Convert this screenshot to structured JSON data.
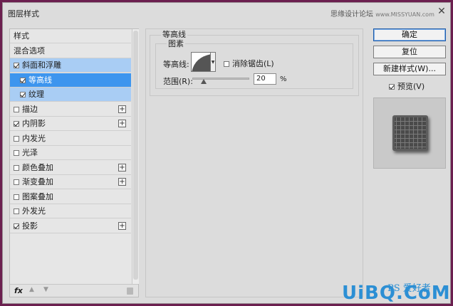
{
  "window": {
    "title": "图层样式",
    "watermark": "思缘设计论坛",
    "watermark_url": "www.MISSYUAN.com",
    "close": "✕"
  },
  "stylelist": {
    "items": [
      {
        "label": "样式",
        "checkbox": false,
        "checked": false,
        "plus": false,
        "state": "normal"
      },
      {
        "label": "混合选项",
        "checkbox": false,
        "checked": false,
        "plus": false,
        "state": "normal"
      },
      {
        "label": "斜面和浮雕",
        "checkbox": true,
        "checked": true,
        "plus": false,
        "state": "light"
      },
      {
        "label": "等高线",
        "checkbox": true,
        "checked": true,
        "plus": false,
        "state": "dark",
        "indent": true
      },
      {
        "label": "纹理",
        "checkbox": true,
        "checked": true,
        "plus": false,
        "state": "light",
        "indent": true
      },
      {
        "label": "描边",
        "checkbox": true,
        "checked": false,
        "plus": true,
        "state": "normal"
      },
      {
        "label": "内阴影",
        "checkbox": true,
        "checked": true,
        "plus": true,
        "state": "normal"
      },
      {
        "label": "内发光",
        "checkbox": true,
        "checked": false,
        "plus": false,
        "state": "normal"
      },
      {
        "label": "光泽",
        "checkbox": true,
        "checked": false,
        "plus": false,
        "state": "normal"
      },
      {
        "label": "颜色叠加",
        "checkbox": true,
        "checked": false,
        "plus": true,
        "state": "normal"
      },
      {
        "label": "渐变叠加",
        "checkbox": true,
        "checked": false,
        "plus": true,
        "state": "normal"
      },
      {
        "label": "图案叠加",
        "checkbox": true,
        "checked": false,
        "plus": false,
        "state": "normal"
      },
      {
        "label": "外发光",
        "checkbox": true,
        "checked": false,
        "plus": false,
        "state": "normal"
      },
      {
        "label": "投影",
        "checkbox": true,
        "checked": true,
        "plus": true,
        "state": "normal"
      }
    ],
    "footer": {
      "fx": "fx"
    }
  },
  "contour_panel": {
    "group_title": "等高线",
    "subgroup_title": "图素",
    "contour_label": "等高线:",
    "antialias_label": "消除锯齿(L)",
    "antialias_checked": false,
    "range_label": "范围(R):",
    "range_value": "20",
    "range_unit": "%",
    "range_fraction": 0.2
  },
  "buttons": {
    "ok": "确定",
    "reset": "复位",
    "new_style": "新建样式(W)...",
    "preview_label": "预览(V)",
    "preview_checked": true
  },
  "logo": {
    "text": "UiBQ.CoM",
    "sub": "PS 爱好者"
  }
}
